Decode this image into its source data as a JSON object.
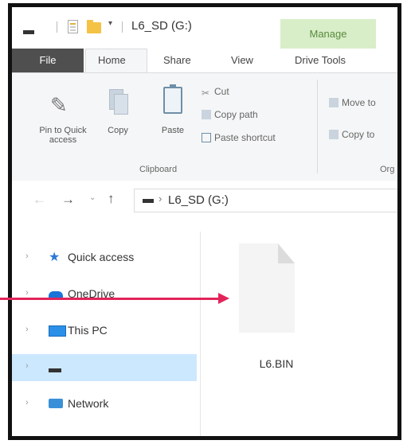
{
  "titlebar": {
    "title": "L6_SD (G:)",
    "qa_dropdown": "▾",
    "contextual_tab": "Manage"
  },
  "ribbon_tabs": {
    "file": "File",
    "home": "Home",
    "share": "Share",
    "view": "View",
    "drive_tools": "Drive Tools"
  },
  "ribbon": {
    "pin_label_line1": "Pin to Quick",
    "pin_label_line2": "access",
    "copy_label": "Copy",
    "paste_label": "Paste",
    "cut_label": "Cut",
    "copy_path_label": "Copy path",
    "paste_shortcut_label": "Paste shortcut",
    "clipboard_group": "Clipboard",
    "move_to_label": "Move to",
    "copy_to_label": "Copy to",
    "organize_group": "Org"
  },
  "addressbar": {
    "path": "L6_SD (G:)",
    "separator": "›"
  },
  "navpane": {
    "items": [
      {
        "label": "Quick access"
      },
      {
        "label": "OneDrive"
      },
      {
        "label": "This PC"
      },
      {
        "label": ""
      },
      {
        "label": "Network"
      }
    ]
  },
  "content": {
    "file_name": "L6.BIN"
  },
  "colors": {
    "manage_tab_bg": "#d8eec9",
    "file_tab_bg": "#4f4f4f",
    "selected_bg": "#cce8ff",
    "annotation_arrow": "#e2245a"
  }
}
